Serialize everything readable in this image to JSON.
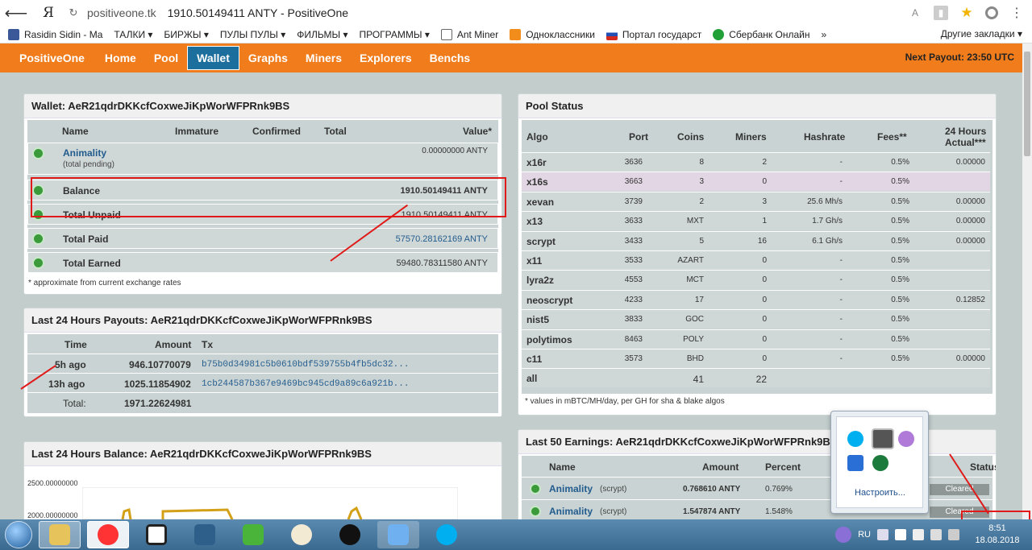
{
  "browser": {
    "url_domain": "positiveone.tk",
    "url_title": "1910.50149411 ANTY - PositiveOne",
    "logo": "Я"
  },
  "bookmarks": [
    "Rasidin Sidin - Ma",
    "ТАЛКИ ▾",
    "БИРЖЫ ▾",
    "ПУЛЫ ПУЛЫ ▾",
    "ФИЛЬМЫ ▾",
    "ПРОГРАММЫ ▾",
    "Ant Miner",
    "Одноклассники",
    "Портал государст",
    "Сбербанк Онлайн",
    "»"
  ],
  "bookmarks_other": "Другие закладки ▾",
  "nav": {
    "brand": "PositiveOne",
    "items": [
      "Home",
      "Pool",
      "Wallet",
      "Graphs",
      "Miners",
      "Explorers",
      "Benchs"
    ],
    "next_payout": "Next Payout: 23:50 UTC"
  },
  "wallet": {
    "title": "Wallet: AeR21qdrDKKcfCoxweJiKpWorWFPRnk9BS",
    "headers": [
      "Name",
      "Immature",
      "Confirmed",
      "Total",
      "Value*"
    ],
    "rows": [
      {
        "name": "Animality",
        "sub": "(total pending)",
        "value": "0.00000000 ANTY"
      },
      {
        "name": "Balance",
        "value": "1910.50149411 ANTY"
      },
      {
        "name": "Total Unpaid",
        "value": "1910.50149411 ANTY"
      },
      {
        "name": "Total Paid",
        "value": "57570.28162169 ANTY"
      },
      {
        "name": "Total Earned",
        "value": "59480.78311580 ANTY"
      }
    ],
    "note": "* approximate from current exchange rates"
  },
  "payouts": {
    "title": "Last 24 Hours Payouts: AeR21qdrDKKcfCoxweJiKpWorWFPRnk9BS",
    "headers": [
      "Time",
      "Amount",
      "Tx"
    ],
    "rows": [
      {
        "time": "5h ago",
        "amount": "946.10770079",
        "tx": "b75b0d34981c5b0610bdf539755b4fb5dc32..."
      },
      {
        "time": "13h ago",
        "amount": "1025.11854902",
        "tx": "1cb244587b367e9469bc945cd9a89c6a921b..."
      }
    ],
    "total_label": "Total:",
    "total": "1971.22624981"
  },
  "balance": {
    "title": "Last 24 Hours Balance: AeR21qdrDKKcfCoxweJiKpWorWFPRnk9BS",
    "y_ticks": [
      "2500.00000000",
      "2000.00000000"
    ]
  },
  "pool": {
    "title": "Pool Status",
    "headers": [
      "Algo",
      "Port",
      "Coins",
      "Miners",
      "Hashrate",
      "Fees**",
      "24 Hours",
      "Actual***"
    ],
    "rows": [
      {
        "algo": "x16r",
        "port": "3636",
        "coins": "8",
        "miners": "2",
        "hash": "-",
        "fees": "0.5%",
        "actual": "0.00000"
      },
      {
        "algo": "x16s",
        "port": "3663",
        "coins": "3",
        "miners": "0",
        "hash": "-",
        "fees": "0.5%",
        "actual": ""
      },
      {
        "algo": "xevan",
        "port": "3739",
        "coins": "2",
        "miners": "3",
        "hash": "25.6 Mh/s",
        "fees": "0.5%",
        "actual": "0.00000"
      },
      {
        "algo": "x13",
        "port": "3633",
        "coins": "MXT",
        "miners": "1",
        "hash": "1.7 Gh/s",
        "fees": "0.5%",
        "actual": "0.00000"
      },
      {
        "algo": "scrypt",
        "port": "3433",
        "coins": "5",
        "miners": "16",
        "hash": "6.1 Gh/s",
        "fees": "0.5%",
        "actual": "0.00000"
      },
      {
        "algo": "x11",
        "port": "3533",
        "coins": "AZART",
        "miners": "0",
        "hash": "-",
        "fees": "0.5%",
        "actual": ""
      },
      {
        "algo": "lyra2z",
        "port": "4553",
        "coins": "MCT",
        "miners": "0",
        "hash": "-",
        "fees": "0.5%",
        "actual": ""
      },
      {
        "algo": "neoscrypt",
        "port": "4233",
        "coins": "17",
        "miners": "0",
        "hash": "-",
        "fees": "0.5%",
        "actual": "0.12852"
      },
      {
        "algo": "nist5",
        "port": "3833",
        "coins": "GOC",
        "miners": "0",
        "hash": "-",
        "fees": "0.5%",
        "actual": ""
      },
      {
        "algo": "polytimos",
        "port": "8463",
        "coins": "POLY",
        "miners": "0",
        "hash": "-",
        "fees": "0.5%",
        "actual": ""
      },
      {
        "algo": "c11",
        "port": "3573",
        "coins": "BHD",
        "miners": "0",
        "hash": "-",
        "fees": "0.5%",
        "actual": "0.00000"
      },
      {
        "algo": "all",
        "port": "",
        "coins": "41",
        "miners": "22",
        "hash": "",
        "fees": "",
        "actual": ""
      }
    ],
    "note": "* values in mBTC/MH/day, per GH for sha & blake algos"
  },
  "earnings": {
    "title": "Last 50 Earnings: AeR21qdrDKKcfCoxweJiKpWorWFPRnk9BS",
    "headers": [
      "Name",
      "Amount",
      "Percent",
      "Status"
    ],
    "rows": [
      {
        "name": "Animality",
        "algo": "(scrypt)",
        "amount": "0.768610 ANTY",
        "percent": "0.769%",
        "status": "Cleared"
      },
      {
        "name": "Animality",
        "algo": "(scrypt)",
        "amount": "1.547874 ANTY",
        "percent": "1.548%",
        "status": "Cleared"
      }
    ]
  },
  "tray": {
    "lang": "RU",
    "customize": "Настроить...",
    "time": "8:51",
    "date": "18.08.2018"
  }
}
